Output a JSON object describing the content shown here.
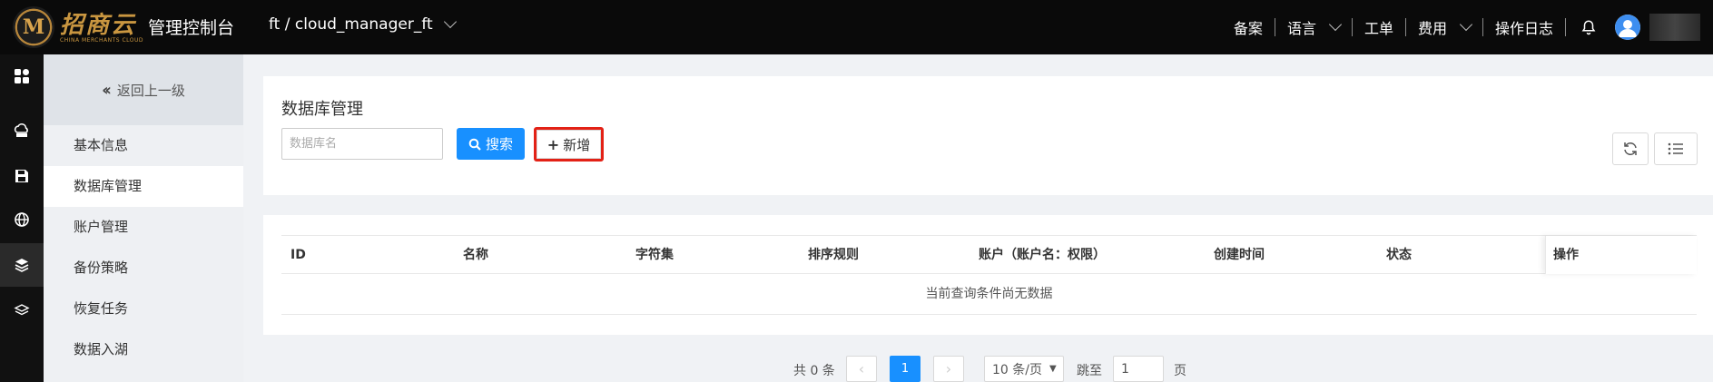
{
  "header": {
    "logo_cn": "招商云",
    "logo_en": "CHINA MERCHANTS CLOUD",
    "logo_mark": "M",
    "app_title": "管理控制台",
    "project": "ft / cloud_manager_ft",
    "nav": {
      "filing": "备案",
      "language": "语言",
      "ticket": "工单",
      "billing": "费用",
      "oplog": "操作日志"
    }
  },
  "rail_icons": [
    "dashboard-icon",
    "cloud-server-icon",
    "storage-icon",
    "network-globe-icon",
    "database-icon",
    "layers-icon"
  ],
  "sidebar": {
    "back_label": "返回上一级",
    "items": [
      {
        "label": "基本信息",
        "active": false
      },
      {
        "label": "数据库管理",
        "active": true
      },
      {
        "label": "账户管理",
        "active": false
      },
      {
        "label": "备份策略",
        "active": false
      },
      {
        "label": "恢复任务",
        "active": false
      },
      {
        "label": "数据入湖",
        "active": false
      }
    ]
  },
  "main": {
    "title": "数据库管理",
    "search_placeholder": "数据库名",
    "search_label": "搜索",
    "add_label": "新增",
    "accent": "#1890ff",
    "highlight": "#e32116"
  },
  "table": {
    "columns": [
      "ID",
      "名称",
      "字符集",
      "排序规则",
      "账户（账户名：权限）",
      "创建时间",
      "状态"
    ],
    "op_column": "操作",
    "empty_text": "当前查询条件尚无数据"
  },
  "pagination": {
    "total": "共 0 条",
    "current": "1",
    "page_size": "10 条/页",
    "jump_label": "跳至",
    "jump_value": "1",
    "page_suffix": "页"
  }
}
